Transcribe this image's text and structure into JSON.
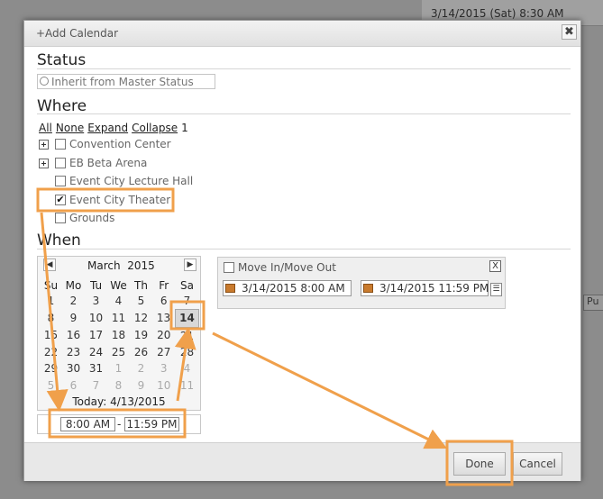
{
  "background": {
    "top_right_text": "3/14/2015 (Sat)  8:30 AM",
    "side_button_text": "Pu"
  },
  "dialog": {
    "title": "+Add Calendar",
    "close_glyph": "✖"
  },
  "status": {
    "heading": "Status",
    "inherit_label": "Inherit from Master Status"
  },
  "where": {
    "heading": "Where",
    "links": {
      "all": "All",
      "none": "None",
      "expand": "Expand",
      "collapse": "Collapse",
      "count": "1"
    },
    "items": [
      {
        "label": "Convention Center",
        "expandable": true,
        "checked": false
      },
      {
        "label": "EB Beta Arena",
        "expandable": true,
        "checked": false
      },
      {
        "label": "Event City Lecture Hall",
        "expandable": false,
        "checked": false
      },
      {
        "label": "Event City Theater",
        "expandable": false,
        "checked": true
      },
      {
        "label": "Grounds",
        "expandable": false,
        "checked": false
      }
    ]
  },
  "when": {
    "heading": "When",
    "calendar": {
      "month": "March",
      "year": "2015",
      "weekdays": [
        "Su",
        "Mo",
        "Tu",
        "We",
        "Th",
        "Fr",
        "Sa"
      ],
      "weeks": [
        [
          "1",
          "2",
          "3",
          "4",
          "5",
          "6",
          "7"
        ],
        [
          "8",
          "9",
          "10",
          "11",
          "12",
          "13",
          "14"
        ],
        [
          "15",
          "16",
          "17",
          "18",
          "19",
          "20",
          "21"
        ],
        [
          "22",
          "23",
          "24",
          "25",
          "26",
          "27",
          "28"
        ],
        [
          "29",
          "30",
          "31",
          "1",
          "2",
          "3",
          "4"
        ],
        [
          "5",
          "6",
          "7",
          "8",
          "9",
          "10",
          "11"
        ]
      ],
      "selected_day": "14",
      "today_label": "Today: 4/13/2015"
    },
    "time_start": "8:00 AM",
    "time_sep": "-",
    "time_end": "11:59 PM",
    "move": {
      "label": "Move In/Move Out",
      "start": "3/14/2015  8:00 AM",
      "end": "3/14/2015  11:59 PM",
      "close_glyph": "X"
    }
  },
  "footer": {
    "done_label": "Done",
    "cancel_label": "Cancel"
  },
  "colors": {
    "annotation": "#f0a04b",
    "overlay": "#8c8c8c"
  }
}
